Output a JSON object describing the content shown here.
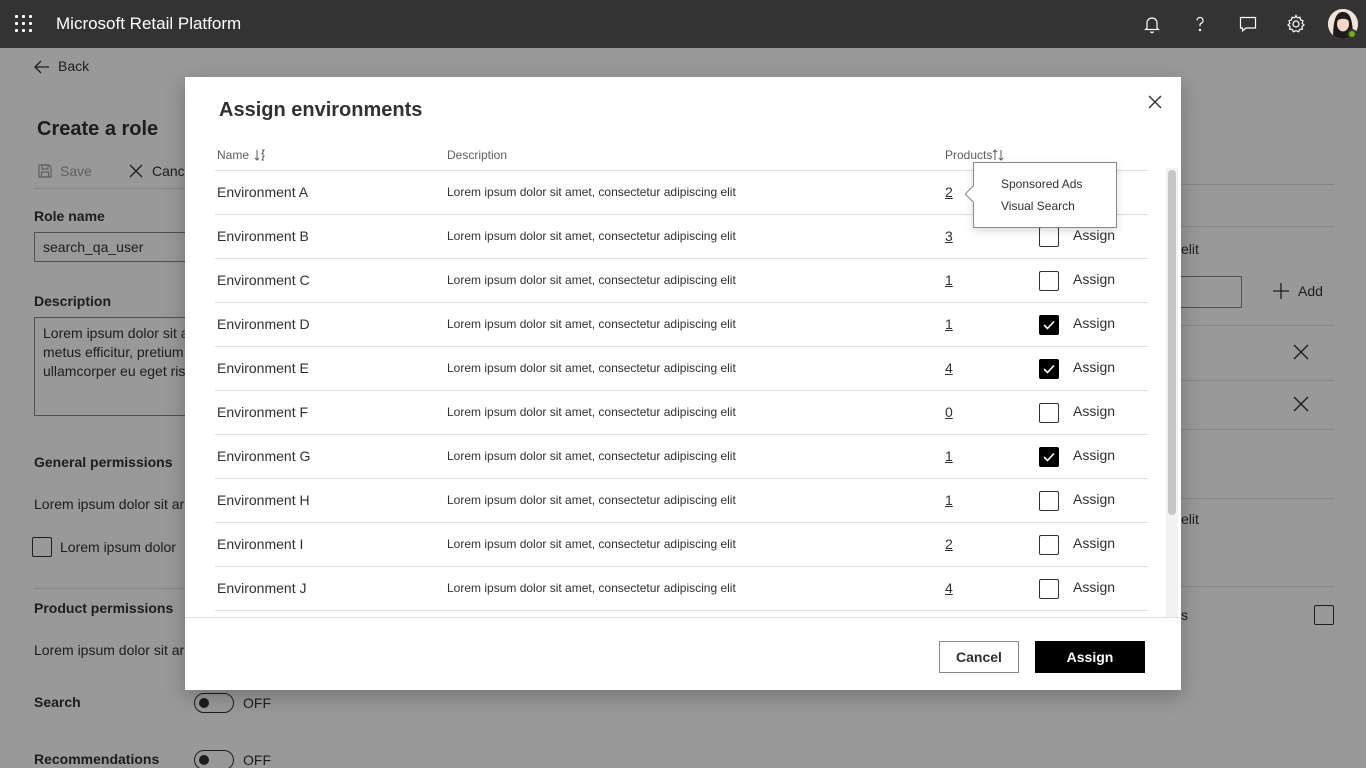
{
  "app": {
    "title": "Microsoft Retail Platform"
  },
  "topbar": {
    "icons": [
      "notification-bell-icon",
      "help-icon",
      "feedback-icon",
      "settings-gear-icon"
    ]
  },
  "page": {
    "back_label": "Back",
    "title": "Create a role",
    "toolbar": {
      "save_label": "Save",
      "cancel_label": "Cance"
    },
    "role_name": {
      "label": "Role name",
      "value": "search_qa_user"
    },
    "description": {
      "label": "Description",
      "lines": [
        "Lorem ipsum dolor sit a",
        "metus efficitur, pretium",
        "ullamcorper eu eget ris"
      ]
    },
    "general_permissions": {
      "heading": "General permissions",
      "text": "Lorem ipsum dolor sit ar",
      "checkbox_label": "Lorem ipsum dolor"
    },
    "product_permissions": {
      "heading": "Product permissions",
      "text": "Lorem ipsum dolor sit ar"
    },
    "toggles": [
      {
        "label": "Search",
        "state": "OFF"
      },
      {
        "label": "Recommendations",
        "state": "OFF"
      }
    ],
    "right_fragments": {
      "text1": "elit",
      "text2": "elit",
      "text3": "s",
      "add_label": "Add"
    }
  },
  "dialog": {
    "title": "Assign environments",
    "columns": {
      "name": "Name",
      "description": "Description",
      "products": "Products"
    },
    "rows": [
      {
        "name": "Environment A",
        "description": "Lorem ipsum dolor sit amet, consectetur adipiscing elit",
        "products": "2",
        "assigned": false,
        "assign_label": "Assign"
      },
      {
        "name": "Environment B",
        "description": "Lorem ipsum dolor sit amet, consectetur adipiscing elit",
        "products": "3",
        "assigned": false,
        "assign_label": "Assign"
      },
      {
        "name": "Environment C",
        "description": "Lorem ipsum dolor sit amet, consectetur adipiscing elit",
        "products": "1",
        "assigned": false,
        "assign_label": "Assign"
      },
      {
        "name": "Environment D",
        "description": "Lorem ipsum dolor sit amet, consectetur adipiscing elit",
        "products": "1",
        "assigned": true,
        "assign_label": "Assign"
      },
      {
        "name": "Environment E",
        "description": "Lorem ipsum dolor sit amet, consectetur adipiscing elit",
        "products": "4",
        "assigned": true,
        "assign_label": "Assign"
      },
      {
        "name": "Environment F",
        "description": "Lorem ipsum dolor sit amet, consectetur adipiscing elit",
        "products": "0",
        "assigned": false,
        "assign_label": "Assign"
      },
      {
        "name": "Environment G",
        "description": "Lorem ipsum dolor sit amet, consectetur adipiscing elit",
        "products": "1",
        "assigned": true,
        "assign_label": "Assign"
      },
      {
        "name": "Environment H",
        "description": "Lorem ipsum dolor sit amet, consectetur adipiscing elit",
        "products": "1",
        "assigned": false,
        "assign_label": "Assign"
      },
      {
        "name": "Environment I",
        "description": "Lorem ipsum dolor sit amet, consectetur adipiscing elit",
        "products": "2",
        "assigned": false,
        "assign_label": "Assign"
      },
      {
        "name": "Environment J",
        "description": "Lorem ipsum dolor sit amet, consectetur adipiscing elit",
        "products": "4",
        "assigned": false,
        "assign_label": "Assign"
      }
    ],
    "callout_items": [
      "Sponsored Ads",
      "Visual Search"
    ],
    "cancel_label": "Cancel",
    "assign_label": "Assign"
  }
}
